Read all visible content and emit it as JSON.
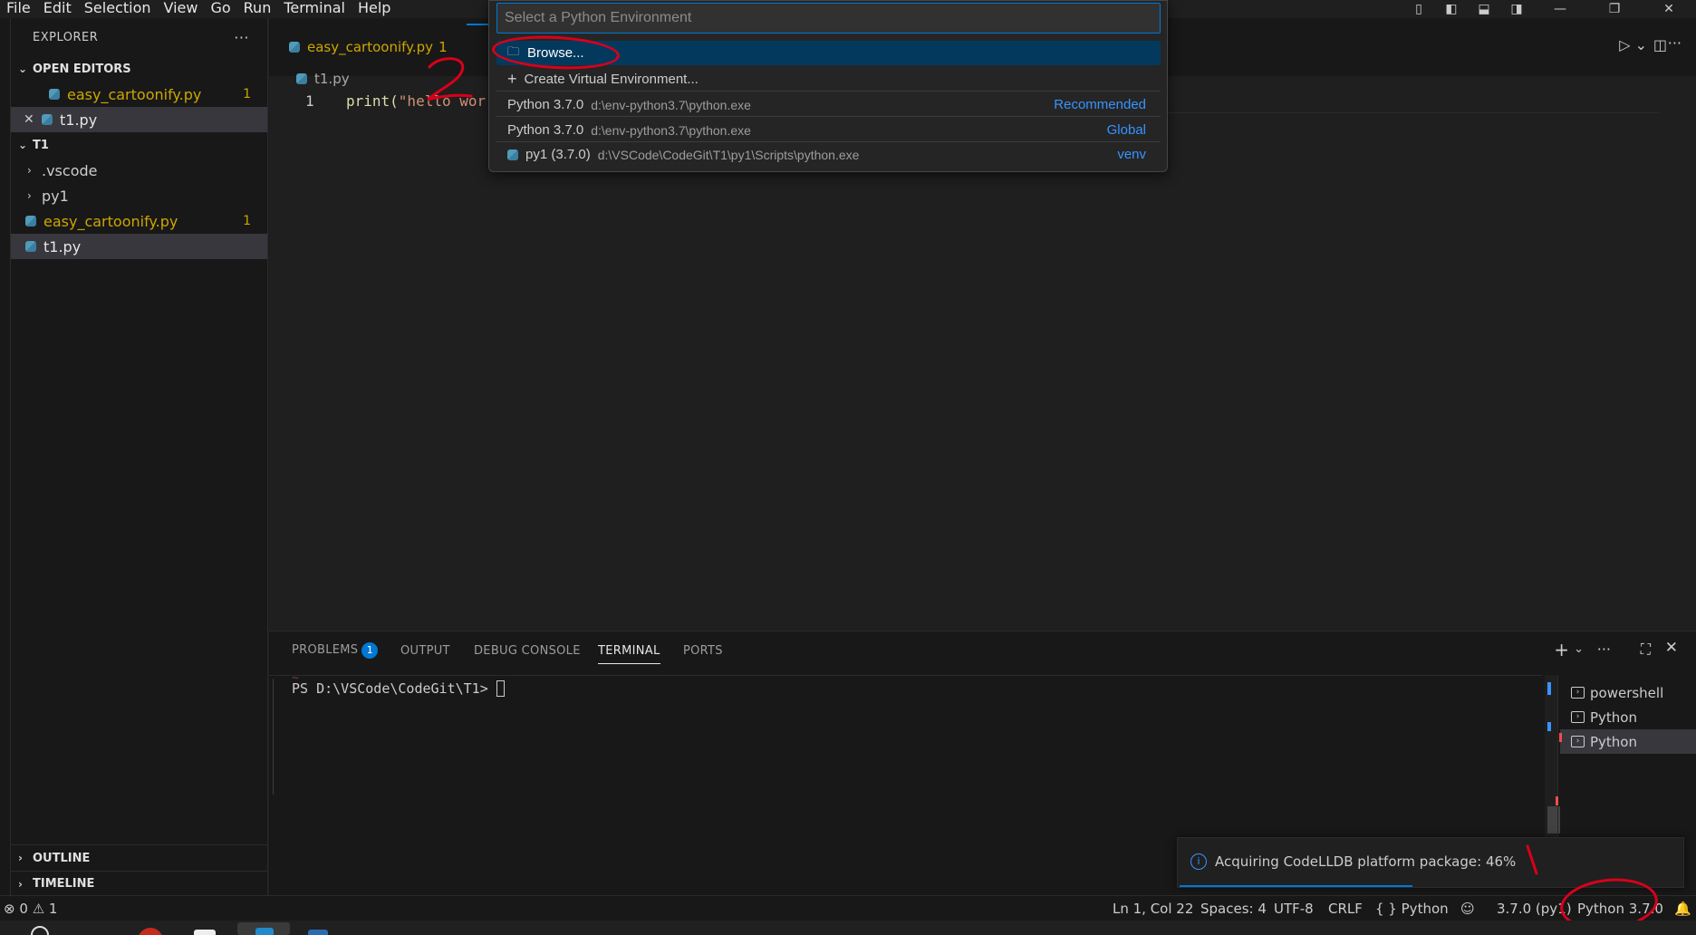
{
  "menu": [
    "File",
    "Edit",
    "Selection",
    "View",
    "Go",
    "Run",
    "Terminal",
    "Help"
  ],
  "sidebar": {
    "title": "EXPLORER",
    "more": "···",
    "open_editors": {
      "title": "OPEN EDITORS",
      "items": [
        {
          "name": "easy_cartoonify.py",
          "badge": "1"
        },
        {
          "name": "t1.py",
          "close": "✕"
        }
      ]
    },
    "folder": {
      "title": "T1",
      "items": [
        {
          "name": ".vscode"
        },
        {
          "name": "py1"
        },
        {
          "name": "easy_cartoonify.py",
          "badge": "1"
        },
        {
          "name": "t1.py"
        }
      ]
    },
    "outline": "OUTLINE",
    "timeline": "TIMELINE"
  },
  "tabs": [
    {
      "label": "easy_cartoonify.py",
      "badge": "1"
    }
  ],
  "editor": {
    "breadcrumb": "t1.py",
    "line_number": "1",
    "code_fn": "print(",
    "code_str": "\"hello wor"
  },
  "quickpick": {
    "placeholder": "Select a Python Environment",
    "items": [
      {
        "label": "Browse...",
        "icon": "folder-icon"
      },
      {
        "label": "Create Virtual Environment...",
        "icon": "plus-icon"
      },
      {
        "label": "Python 3.7.0",
        "desc": "d:\\env-python3.7\\python.exe",
        "detail": "Recommended"
      },
      {
        "label": "Python 3.7.0",
        "desc": "d:\\env-python3.7\\python.exe",
        "detail": "Global"
      },
      {
        "label": "py1 (3.7.0)",
        "desc": "d:\\VSCode\\CodeGit\\T1\\py1\\Scripts\\python.exe",
        "detail": "venv"
      }
    ]
  },
  "panel": {
    "tabs": [
      {
        "label": "PROBLEMS",
        "badge": "1"
      },
      {
        "label": "OUTPUT"
      },
      {
        "label": "DEBUG CONSOLE"
      },
      {
        "label": "TERMINAL"
      },
      {
        "label": "PORTS"
      }
    ],
    "terminal_prompt": "PS D:\\VSCode\\CodeGit\\T1> ",
    "terminal_list": [
      "powershell",
      "Python",
      "Python"
    ]
  },
  "notification": {
    "text": "Acquiring CodeLLDB platform package: 46%",
    "progress": 0.46
  },
  "status": {
    "errors": "0",
    "warnings": "1",
    "position": "Ln 1, Col 22",
    "spaces": "Spaces: 4",
    "encoding": "UTF-8",
    "eol": "CRLF",
    "language": "Python",
    "env": "3.7.0 (py1)",
    "interpreter": "Python 3.7.0"
  },
  "annotations": {
    "number_two": "2",
    "number_one": "1"
  },
  "colors": {
    "accent": "#0078d4",
    "link": "#3794ff",
    "warning": "#cca700",
    "annotation": "#d9001b"
  }
}
